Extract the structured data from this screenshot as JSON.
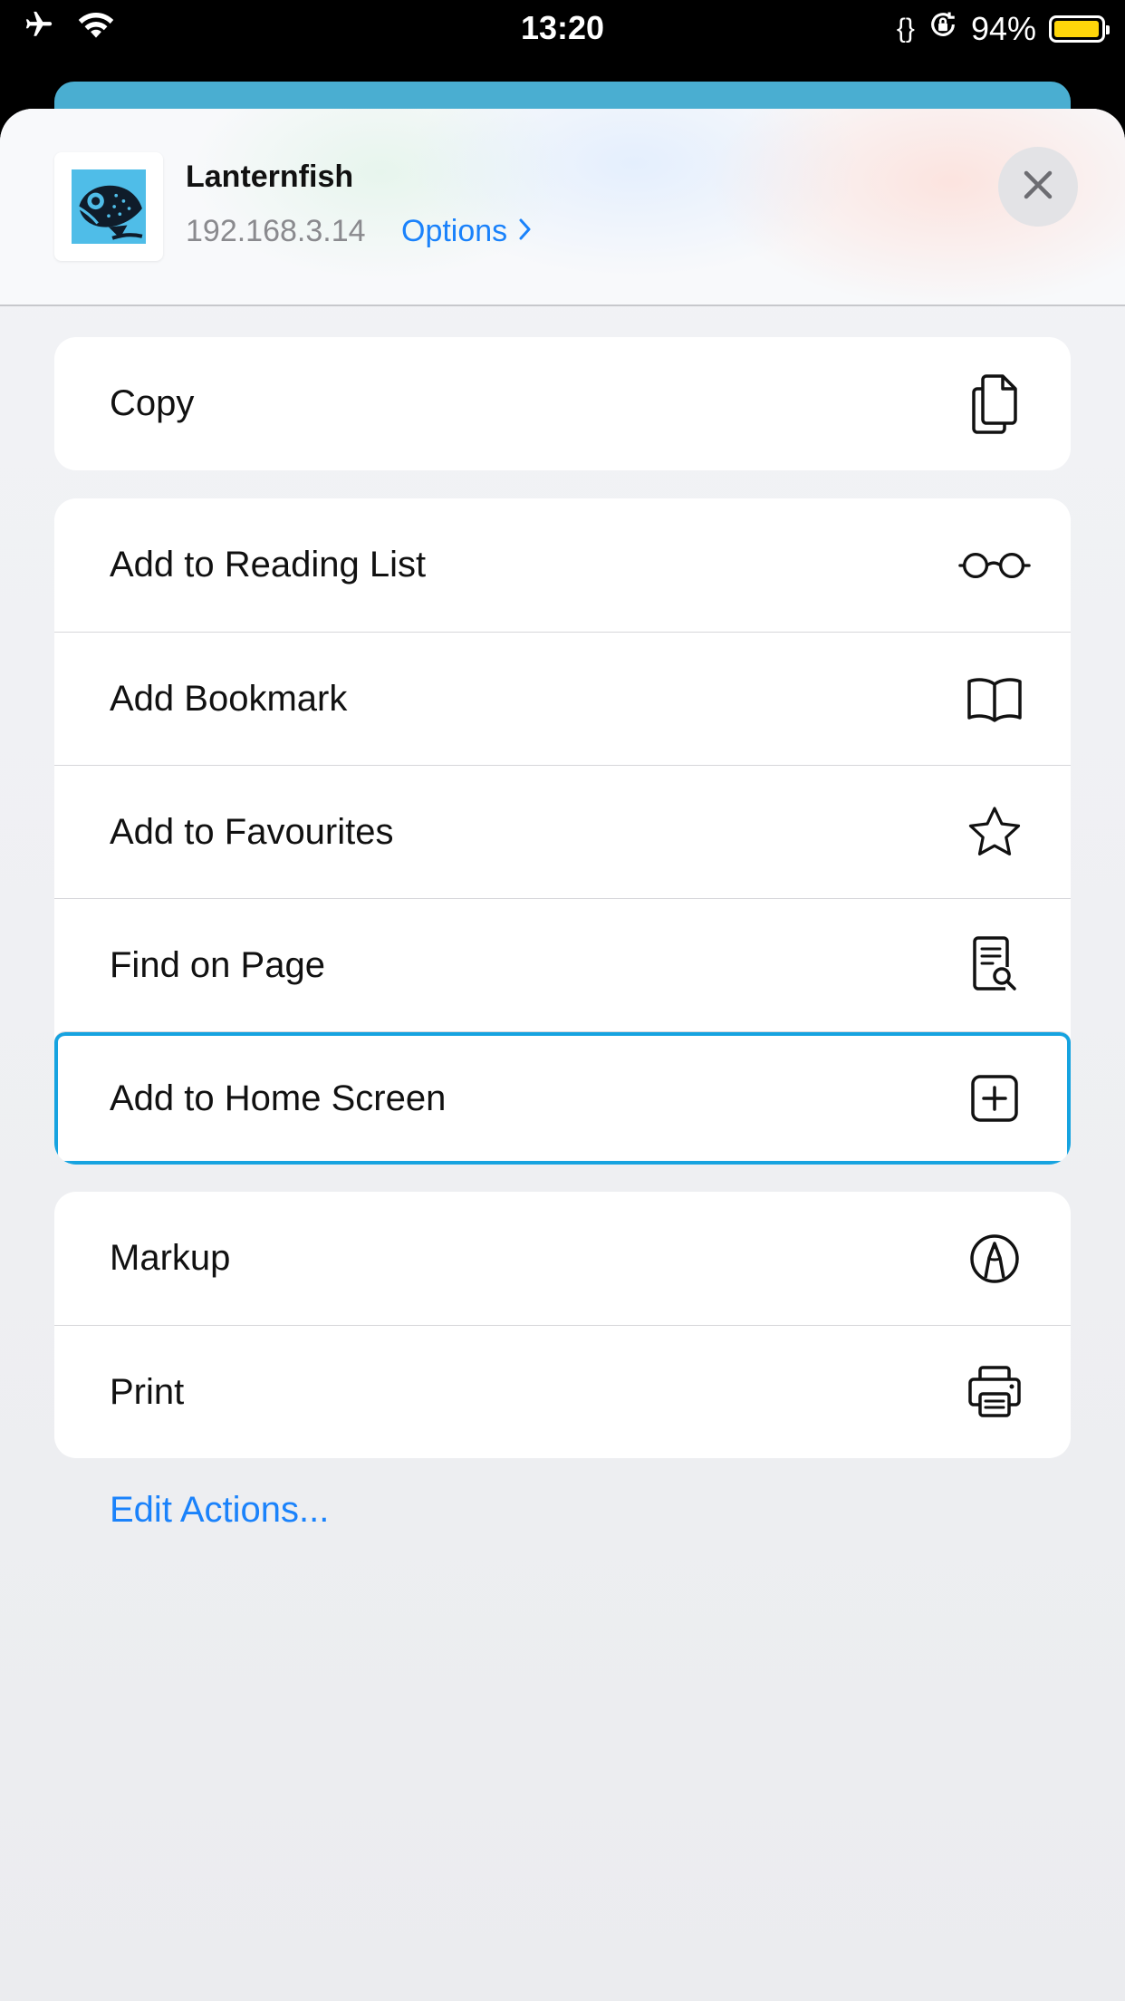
{
  "status_bar": {
    "time": "13:20",
    "battery_percent": "94%",
    "braces": "{}",
    "icons": [
      "airplane-icon",
      "wifi-icon",
      "orientation-lock-icon",
      "battery-icon"
    ]
  },
  "header": {
    "app_name": "Lanternfish",
    "url": "192.168.3.14",
    "options_label": "Options",
    "close_icon": "close-icon"
  },
  "groups": [
    {
      "items": [
        {
          "label": "Copy",
          "icon": "copy-icon"
        }
      ]
    },
    {
      "items": [
        {
          "label": "Add to Reading List",
          "icon": "glasses-icon"
        },
        {
          "label": "Add Bookmark",
          "icon": "book-icon"
        },
        {
          "label": "Add to Favourites",
          "icon": "star-icon"
        },
        {
          "label": "Find on Page",
          "icon": "find-document-icon"
        },
        {
          "label": "Add to Home Screen",
          "icon": "plus-square-icon"
        }
      ]
    },
    {
      "items": [
        {
          "label": "Markup",
          "icon": "markup-pen-icon"
        },
        {
          "label": "Print",
          "icon": "printer-icon"
        }
      ]
    }
  ],
  "edit_actions_label": "Edit Actions...",
  "colors": {
    "accent": "#1a82fb",
    "highlight": "#16a3e0",
    "battery": "#ffd60a"
  }
}
